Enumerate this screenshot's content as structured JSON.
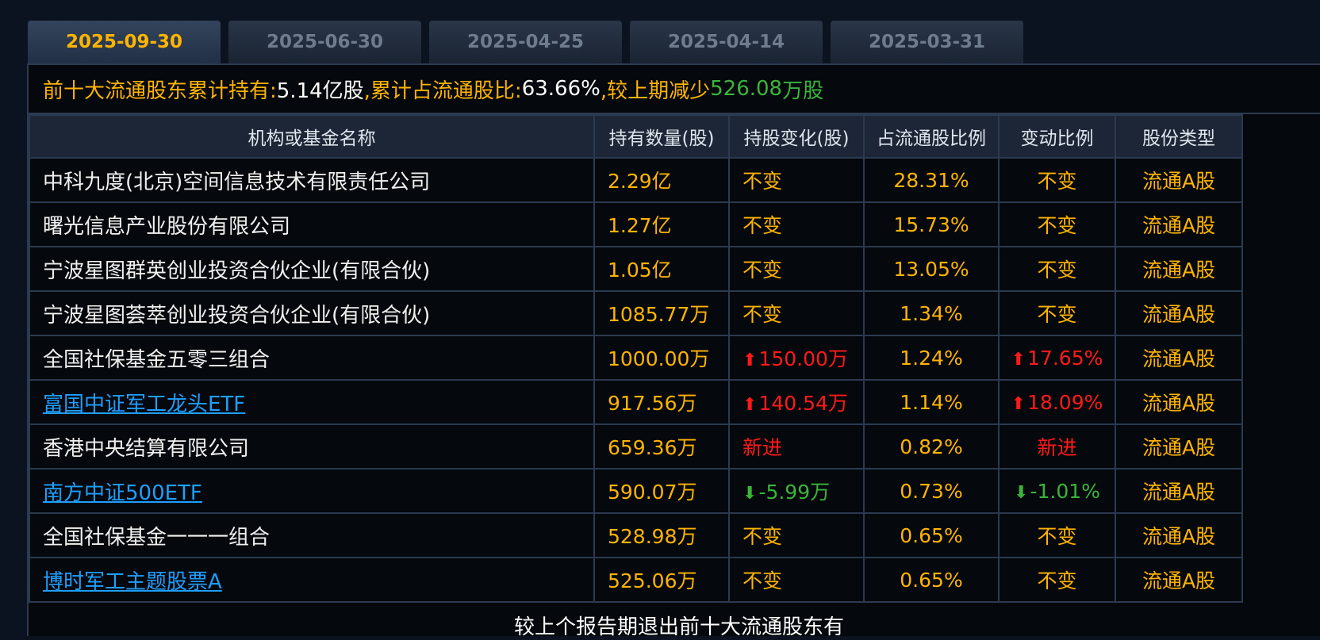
{
  "tabs": [
    {
      "label": "2025-09-30",
      "active": true
    },
    {
      "label": "2025-06-30",
      "active": false
    },
    {
      "label": "2025-04-25",
      "active": false
    },
    {
      "label": "2025-04-14",
      "active": false
    },
    {
      "label": "2025-03-31",
      "active": false
    }
  ],
  "summary": {
    "prefix": "前十大流通股东累计持有:",
    "hold_value": "5.14亿股",
    "mid": ",累计占流通股比:",
    "ratio_value": "63.66%",
    "after": ",较上期减少",
    "decrease_value": "526.08",
    "decrease_unit": "万股"
  },
  "table": {
    "headers": [
      "机构或基金名称",
      "持有数量(股)",
      "持股变化(股)",
      "占流通股比例",
      "变动比例",
      "股份类型"
    ],
    "rows": [
      {
        "name": "中科九度(北京)空间信息技术有限责任公司",
        "link": false,
        "qty": "2.29亿",
        "chg": "不变",
        "chg_dir": "none",
        "ratio": "28.31%",
        "var": "不变",
        "var_dir": "none",
        "type": "流通A股"
      },
      {
        "name": "曙光信息产业股份有限公司",
        "link": false,
        "qty": "1.27亿",
        "chg": "不变",
        "chg_dir": "none",
        "ratio": "15.73%",
        "var": "不变",
        "var_dir": "none",
        "type": "流通A股"
      },
      {
        "name": "宁波星图群英创业投资合伙企业(有限合伙)",
        "link": false,
        "qty": "1.05亿",
        "chg": "不变",
        "chg_dir": "none",
        "ratio": "13.05%",
        "var": "不变",
        "var_dir": "none",
        "type": "流通A股"
      },
      {
        "name": "宁波星图荟萃创业投资合伙企业(有限合伙)",
        "link": false,
        "qty": "1085.77万",
        "chg": "不变",
        "chg_dir": "none",
        "ratio": "1.34%",
        "var": "不变",
        "var_dir": "none",
        "type": "流通A股"
      },
      {
        "name": "全国社保基金五零三组合",
        "link": false,
        "qty": "1000.00万",
        "chg": "150.00万",
        "chg_dir": "up",
        "ratio": "1.24%",
        "var": "17.65%",
        "var_dir": "up",
        "type": "流通A股"
      },
      {
        "name": "富国中证军工龙头ETF",
        "link": true,
        "qty": "917.56万",
        "chg": "140.54万",
        "chg_dir": "up",
        "ratio": "1.14%",
        "var": "18.09%",
        "var_dir": "up",
        "type": "流通A股"
      },
      {
        "name": "香港中央结算有限公司",
        "link": false,
        "qty": "659.36万",
        "chg": "新进",
        "chg_dir": "new",
        "ratio": "0.82%",
        "var": "新进",
        "var_dir": "new",
        "type": "流通A股"
      },
      {
        "name": "南方中证500ETF",
        "link": true,
        "qty": "590.07万",
        "chg": "-5.99万",
        "chg_dir": "down",
        "ratio": "0.73%",
        "var": "-1.01%",
        "var_dir": "down",
        "type": "流通A股"
      },
      {
        "name": "全国社保基金一一一组合",
        "link": false,
        "qty": "528.98万",
        "chg": "不变",
        "chg_dir": "none",
        "ratio": "0.65%",
        "var": "不变",
        "var_dir": "none",
        "type": "流通A股"
      },
      {
        "name": "博时军工主题股票A",
        "link": true,
        "qty": "525.06万",
        "chg": "不变",
        "chg_dir": "none",
        "ratio": "0.65%",
        "var": "不变",
        "var_dir": "none",
        "type": "流通A股"
      }
    ]
  },
  "footer": {
    "text": "较上个报告期退出前十大流通股东有"
  },
  "icons": {
    "up": "arrow-up-icon",
    "down": "arrow-down-icon"
  },
  "colors": {
    "accent": "#ffb400",
    "increase": "#ff1a1a",
    "decrease": "#3ab53a",
    "link": "#1e9fff"
  }
}
